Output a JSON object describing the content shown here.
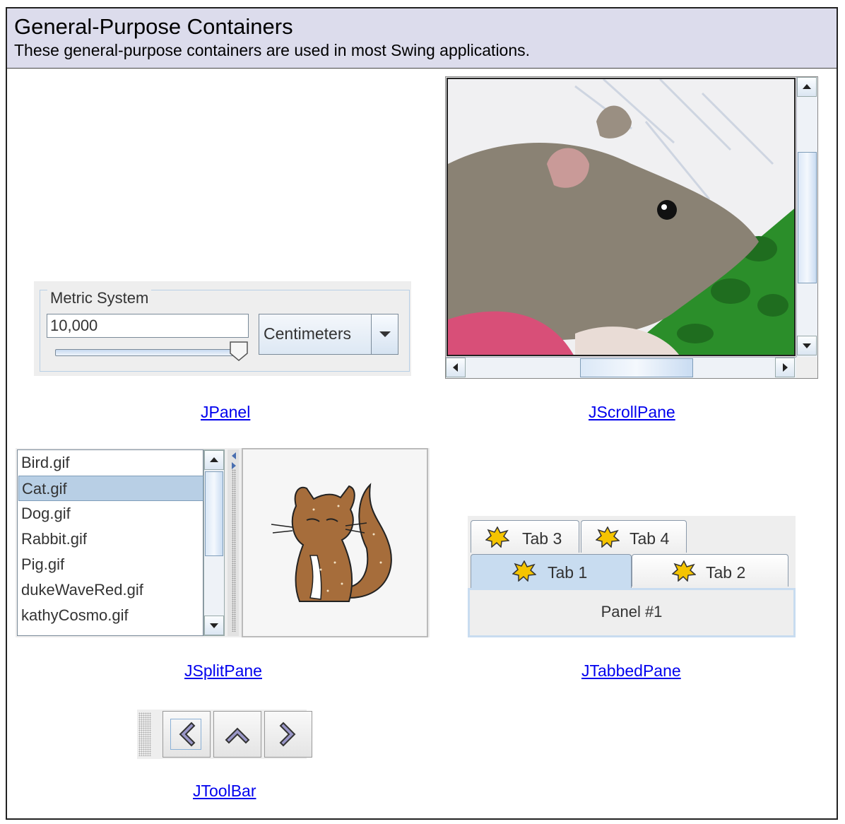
{
  "header": {
    "title": "General-Purpose Containers",
    "subtitle": "These general-purpose containers are used in most Swing applications."
  },
  "jpanel": {
    "legend": "Metric System",
    "field_value": "10,000",
    "combo_value": "Centimeters",
    "slider_level": 1.0,
    "link": "JPanel"
  },
  "jscrollpane": {
    "image_alt": "rat photo",
    "link": "JScrollPane"
  },
  "jsplitpane": {
    "items": [
      "Bird.gif",
      "Cat.gif",
      "Dog.gif",
      "Rabbit.gif",
      "Pig.gif",
      "dukeWaveRed.gif",
      "kathyCosmo.gif"
    ],
    "selected": "Cat.gif",
    "link": "JSplitPane"
  },
  "jtabbedpane": {
    "tabs": [
      "Tab 3",
      "Tab 4",
      "Tab 1",
      "Tab 2"
    ],
    "active_tab": "Tab 1",
    "panel_text": "Panel #1",
    "link": "JTabbedPane"
  },
  "jtoolbar": {
    "buttons": [
      "back-icon",
      "up-icon",
      "forward-icon"
    ],
    "link": "JToolBar"
  }
}
